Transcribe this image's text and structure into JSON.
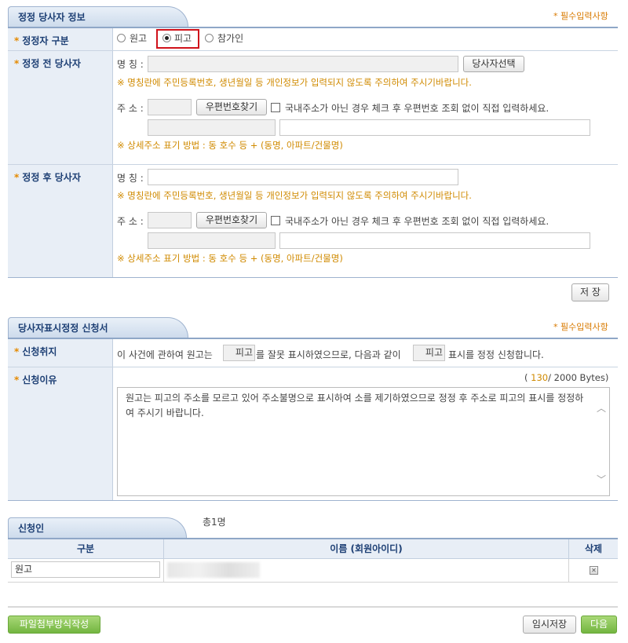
{
  "section1": {
    "title": "정정 당사자 정보",
    "required_note": "* 필수입력사항",
    "kind_label": "정정자 구분",
    "radio_options": [
      "원고",
      "피고",
      "참가인"
    ],
    "selected_option": "피고",
    "before_label": "정정 전 당사자",
    "after_label": "정정 후 당사자",
    "name_label": "명 칭 :",
    "party_select_button": "당사자선택",
    "name_warning": "※ 명칭란에 주민등록번호, 생년월일 등 개인정보가 입력되지 않도록 주의하여 주시기바랍니다.",
    "address_label": "주 소 :",
    "postcode_button": "우편번호찾기",
    "overseas_check_label": "국내주소가 아닌 경우 체크 후 우편번호 조회 없이 직접 입력하세요.",
    "address_hint": "※ 상세주소 표기 방법 : 동 호수 등 + (동명, 아파트/건물명)",
    "save_button": "저 장"
  },
  "section2": {
    "title": "당사자표시정정 신청서",
    "required_note": "* 필수입력사항",
    "purpose_label": "신청취지",
    "purpose_text_1": "이 사건에 관하여 원고는",
    "purpose_value_1": "피고",
    "purpose_text_2": "를 잘못 표시하였으므로, 다음과 같이",
    "purpose_value_2": "피고",
    "purpose_text_3": "표시를 정정 신청합니다.",
    "reason_label": "신청이유",
    "byte_open": "(",
    "byte_count": "130",
    "byte_max": "/ 2000 Bytes)",
    "reason_text": "원고는 피고의 주소를 모르고 있어 주소불명으로 표시하여 소를 제기하였으므로 정정 후 주소로 피고의 표시를 정정하여 주시기 바랍니다."
  },
  "section3": {
    "title": "신청인",
    "total": "총1명",
    "columns": [
      "구분",
      "이름 (회원아이디)",
      "삭제"
    ],
    "rows": [
      {
        "kind": "원고"
      }
    ]
  },
  "footer": {
    "file_attach_button": "파일첨부방식작성",
    "temp_save_button": "임시저장",
    "next_button": "다음"
  },
  "colors": {
    "header_text": "#1d3f74",
    "label_bg": "#e8eef6",
    "required": "#d87a00",
    "warning": "#d08a00",
    "green": "#73b540",
    "highlight": "#d0121b"
  }
}
